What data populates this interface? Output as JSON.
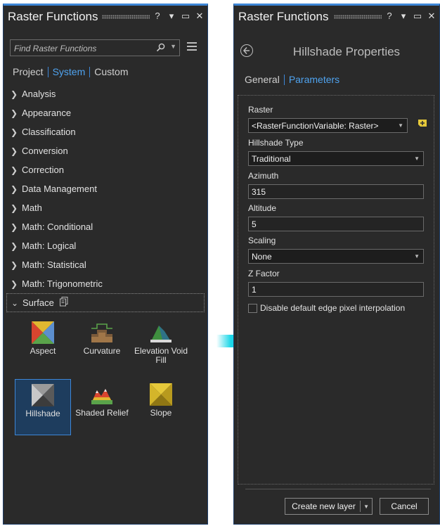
{
  "left_panel": {
    "title": "Raster Functions",
    "title_buttons": [
      "?",
      "▾",
      "▭",
      "✕"
    ],
    "search_placeholder": "Find Raster Functions",
    "tabs": [
      {
        "label": "Project",
        "active": false
      },
      {
        "label": "System",
        "active": true
      },
      {
        "label": "Custom",
        "active": false
      }
    ],
    "categories": [
      "Analysis",
      "Appearance",
      "Classification",
      "Conversion",
      "Correction",
      "Data Management",
      "Math",
      "Math: Conditional",
      "Math: Logical",
      "Math: Statistical",
      "Math: Trigonometric"
    ],
    "expanded_category": "Surface",
    "functions": [
      {
        "label": "Aspect",
        "icon": "aspect-icon"
      },
      {
        "label": "Curvature",
        "icon": "curvature-icon"
      },
      {
        "label": "Elevation Void Fill",
        "icon": "elevation-void-fill-icon"
      },
      {
        "label": "Hillshade",
        "icon": "hillshade-icon",
        "selected": true
      },
      {
        "label": "Shaded Relief",
        "icon": "shaded-relief-icon"
      },
      {
        "label": "Slope",
        "icon": "slope-icon"
      }
    ]
  },
  "right_panel": {
    "title": "Raster Functions",
    "title_buttons": [
      "?",
      "▾",
      "▭",
      "✕"
    ],
    "properties_title": "Hillshade Properties",
    "tabs": [
      {
        "label": "General",
        "active": false
      },
      {
        "label": "Parameters",
        "active": true
      }
    ],
    "params": {
      "raster_label": "Raster",
      "raster_value": "<RasterFunctionVariable: Raster>",
      "hillshade_type_label": "Hillshade Type",
      "hillshade_type_value": "Traditional",
      "azimuth_label": "Azimuth",
      "azimuth_value": "315",
      "altitude_label": "Altitude",
      "altitude_value": "5",
      "scaling_label": "Scaling",
      "scaling_value": "None",
      "zfactor_label": "Z Factor",
      "zfactor_value": "1",
      "disable_interp_label": "Disable default edge pixel interpolation",
      "disable_interp_checked": false
    },
    "buttons": {
      "create_label": "Create new layer",
      "cancel_label": "Cancel"
    }
  },
  "colors": {
    "accent": "#3d86d6",
    "active_tab": "#4fa3ef",
    "panel_bg": "#2a2a2a",
    "arrow": "#19d6e8"
  }
}
